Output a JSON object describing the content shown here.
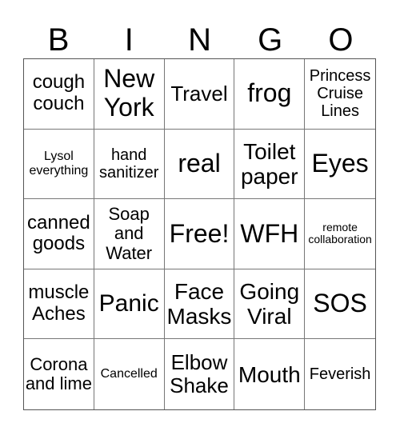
{
  "header": {
    "letters": [
      "B",
      "I",
      "N",
      "G",
      "O"
    ]
  },
  "cells": [
    "cough couch",
    "New York",
    "Travel",
    "frog",
    "Princess Cruise Lines",
    "Lysol everything",
    "hand sanitizer",
    "real",
    "Toilet paper",
    "Eyes",
    "canned goods",
    "Soap and Water",
    "Free!",
    "WFH",
    "remote collaboration",
    "muscle Aches",
    "Panic",
    "Face Masks",
    "Going Viral",
    "SOS",
    "Corona and lime",
    "Cancelled",
    "Elbow Shake",
    "Mouth",
    "Feverish"
  ]
}
